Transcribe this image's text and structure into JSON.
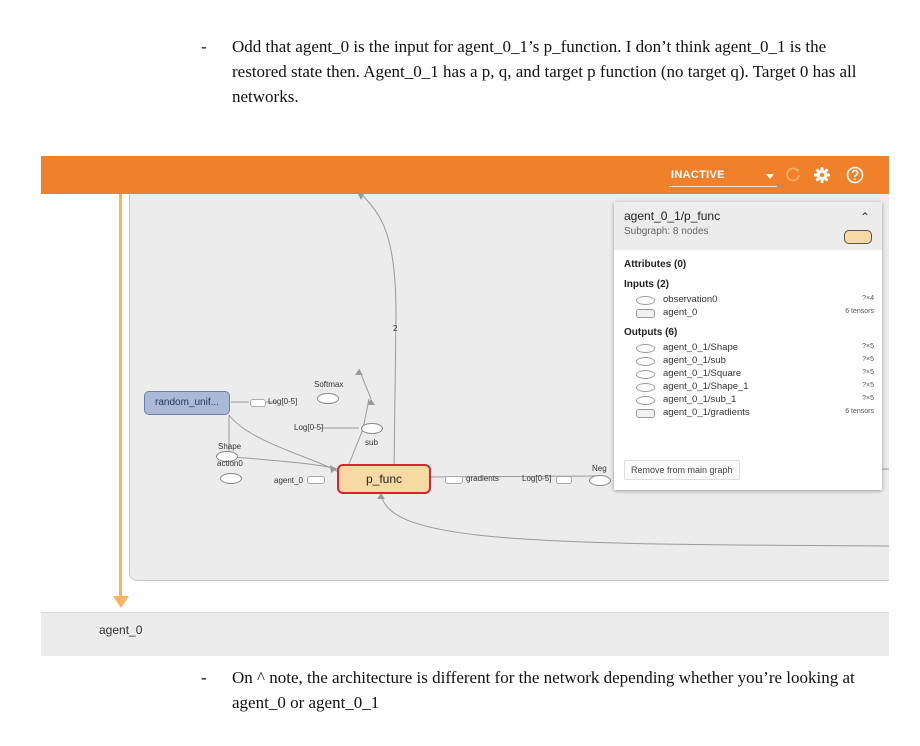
{
  "notes": {
    "top": {
      "dash": "-",
      "text": "Odd that agent_0 is the input for agent_0_1’s p_function. I don’t think agent_0_1 is the restored state then. Agent_0_1 has a p, q, and target p function (no target q). Target 0 has all networks."
    },
    "bottom": {
      "dash": "-",
      "text": "On ^ note, the architecture is different for the network depending whether you’re looking at agent_0 or agent_0_1"
    }
  },
  "toolbar": {
    "status": "INACTIVE",
    "icons": [
      "refresh-icon",
      "gear-icon",
      "help-icon"
    ],
    "bar_color": "#f0802a"
  },
  "graph": {
    "nodes": {
      "random_unif": "random_unif...",
      "p_func": "p_func",
      "softmax": "Softmax",
      "shape": "Shape",
      "sub": "sub",
      "action0": "action0",
      "neg": "Neg",
      "log_a": "Log[0-5]",
      "log_b": "Log[0-5]",
      "log_c": "Log[0-5]",
      "agent_edge": "agent_0",
      "gradients_edge": "gradients",
      "edge_count": "2"
    }
  },
  "info_panel": {
    "title": "agent_0_1/p_func",
    "subtitle": "Subgraph: 8 nodes",
    "attributes_heading": "Attributes (0)",
    "inputs_heading": "Inputs (2)",
    "inputs": [
      {
        "name": "observation0",
        "type": "?×4",
        "shape": "ellipse"
      },
      {
        "name": "agent_0",
        "type": "6 tensors",
        "shape": "rect"
      }
    ],
    "outputs_heading": "Outputs (6)",
    "outputs": [
      {
        "name": "agent_0_1/Shape",
        "type": "?×5",
        "shape": "ellipse"
      },
      {
        "name": "agent_0_1/sub",
        "type": "?×5",
        "shape": "ellipse"
      },
      {
        "name": "agent_0_1/Square",
        "type": "?×5",
        "shape": "ellipse"
      },
      {
        "name": "agent_0_1/Shape_1",
        "type": "?×5",
        "shape": "ellipse"
      },
      {
        "name": "agent_0_1/sub_1",
        "type": "?×5",
        "shape": "ellipse"
      },
      {
        "name": "agent_0_1/gradients",
        "type": "6 tensors",
        "shape": "rect"
      }
    ],
    "remove_button": "Remove from main graph"
  },
  "bottom_panel": {
    "label": "agent_0"
  }
}
